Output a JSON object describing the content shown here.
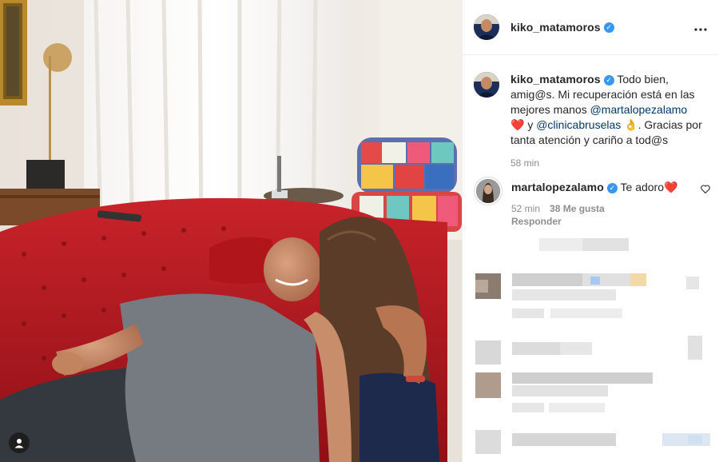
{
  "post": {
    "author": "kiko_matamoros",
    "verified_mark": "✓",
    "more_icon": "more-horizontal-icon",
    "caption_parts": {
      "lead": "Todo bien, amig@s. Mi recuperación está en las mejores manos ",
      "mention1": "@martalopezalamo",
      "heart": "❤️",
      "mid": " y ",
      "mention2": "@clinicabruselas",
      "hand": " 👌",
      "tail": ". Gracias por tanta atención y cariño a tod@s"
    },
    "time": "58 min"
  },
  "comment": {
    "author": "martalopezalamo",
    "verified_mark": "✓",
    "text": "Te adoro",
    "heart": "❤️",
    "time": "52 min",
    "likes": "38 Me gusta",
    "reply": "Responder",
    "like_icon": "heart-outline-icon"
  },
  "photo": {
    "tag_icon": "user-tag-icon"
  },
  "colors": {
    "sofa_red": "#c41e24",
    "verified_blue": "#3897f0",
    "mention_blue": "#00376b",
    "muted_text": "#8e8e8e"
  }
}
